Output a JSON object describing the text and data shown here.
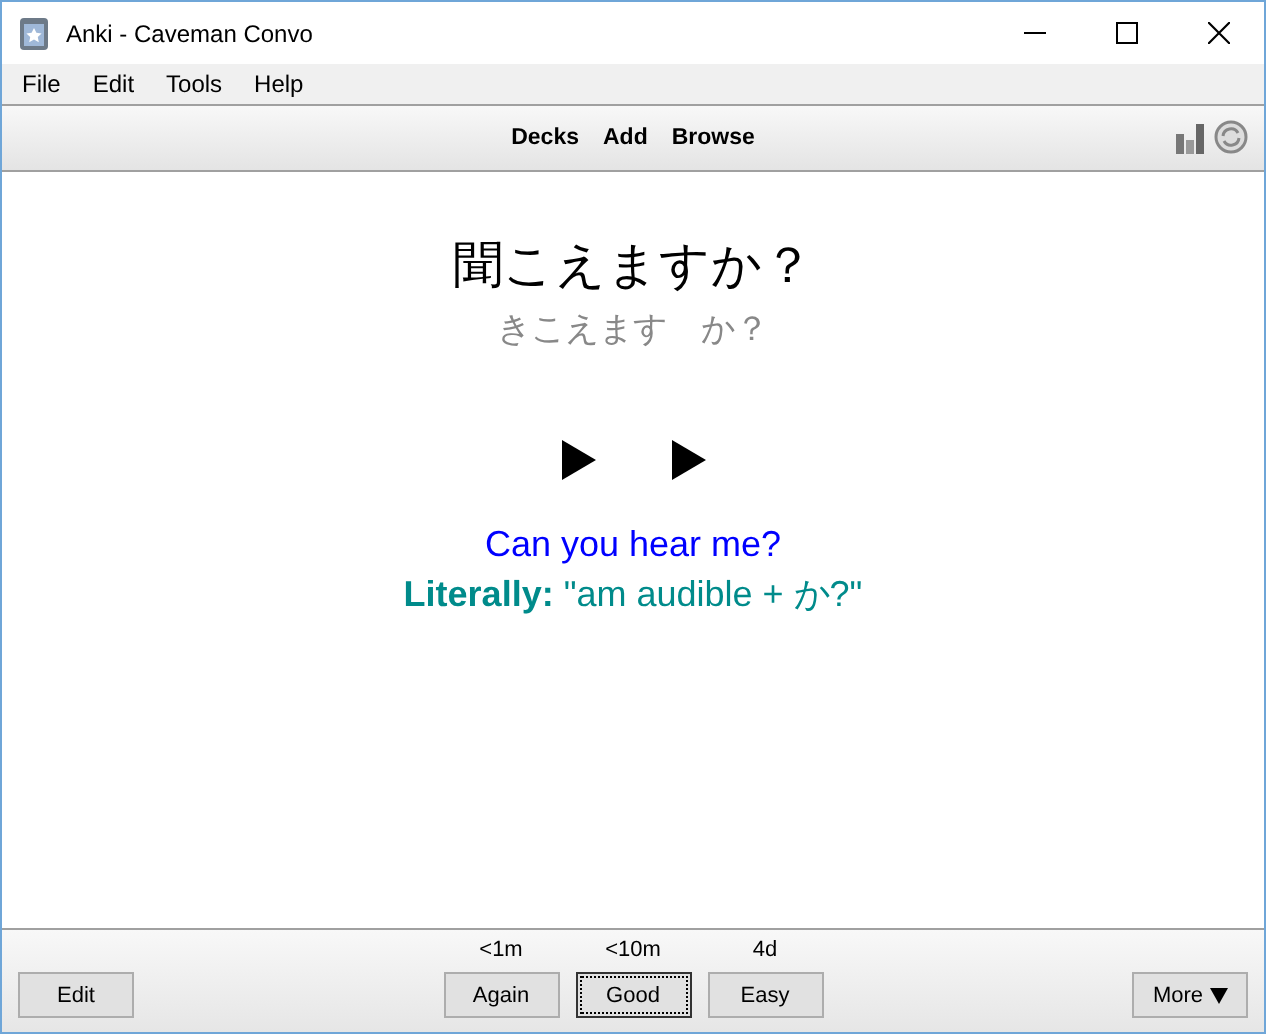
{
  "window": {
    "title": "Anki - Caveman Convo"
  },
  "menu": [
    "File",
    "Edit",
    "Tools",
    "Help"
  ],
  "toolbar": {
    "links": [
      "Decks",
      "Add",
      "Browse"
    ]
  },
  "card": {
    "expression": "聞こえますか？",
    "reading": "きこえます　か？",
    "audio_buttons": [
      {
        "kind": "play"
      },
      {
        "kind": "play"
      }
    ],
    "meaning": "Can you hear me?",
    "literal": "**Literally:** \"am audible + か?\""
  },
  "bottom": {
    "edit": "Edit",
    "answers": [
      {
        "interval": "<1m",
        "label": "Again",
        "focused": false
      },
      {
        "interval": "<10m",
        "label": "Good",
        "focused": true
      },
      {
        "interval": "4d",
        "label": "Easy",
        "focused": false
      }
    ],
    "more": "More"
  }
}
